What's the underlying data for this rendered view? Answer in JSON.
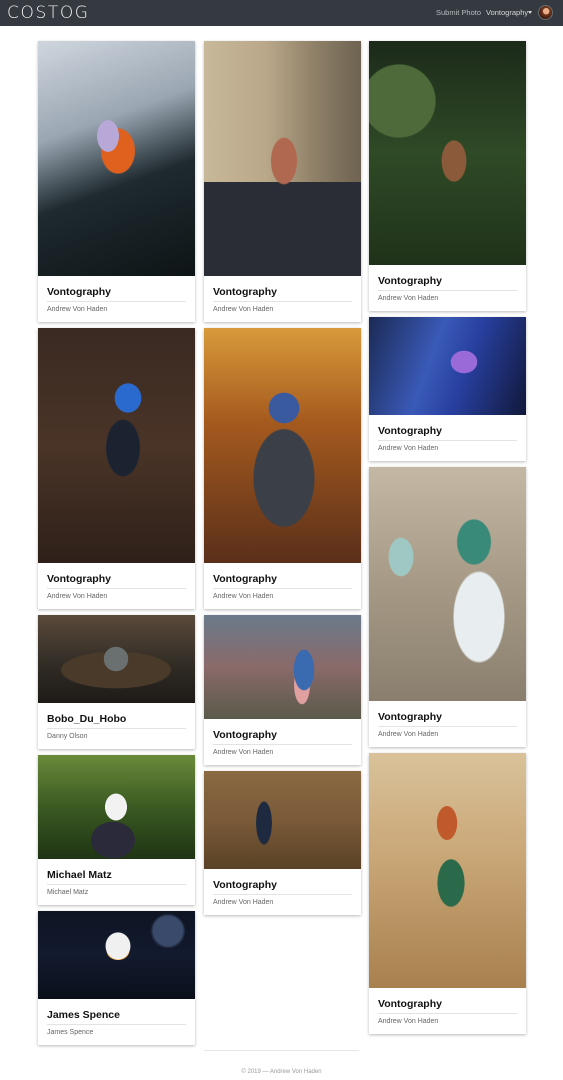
{
  "navbar": {
    "brand": "COSTOG",
    "submit_label": "Submit Photo",
    "user_label": "Vontography"
  },
  "cards": [
    {
      "title": "Vontography",
      "author": "Andrew Von Haden"
    },
    {
      "title": "Vontography",
      "author": "Andrew Von Haden"
    },
    {
      "title": "Vontography",
      "author": "Andrew Von Haden"
    },
    {
      "title": "Vontography",
      "author": "Andrew Von Haden"
    },
    {
      "title": "Vontography",
      "author": "Andrew Von Haden"
    },
    {
      "title": "Vontography",
      "author": "Andrew Von Haden"
    },
    {
      "title": "Vontography",
      "author": "Andrew Von Haden"
    },
    {
      "title": "Bobo_Du_Hobo",
      "author": "Danny Olson"
    },
    {
      "title": "Vontography",
      "author": "Andrew Von Haden"
    },
    {
      "title": "Michael Matz",
      "author": "Michael Matz"
    },
    {
      "title": "Vontography",
      "author": "Andrew Von Haden"
    },
    {
      "title": "Vontography",
      "author": "Andrew Von Haden"
    },
    {
      "title": "James Spence",
      "author": "James Spence"
    }
  ],
  "footer": {
    "text": "© 2019 — Andrew Von Haden"
  },
  "colors": {
    "navbar_bg": "#343a40",
    "page_bg": "#ffffff"
  }
}
